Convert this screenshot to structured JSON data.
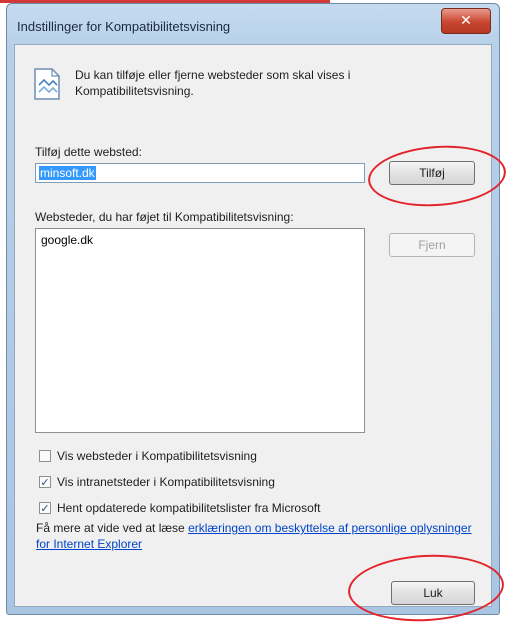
{
  "window": {
    "title": "Indstillinger for Kompatibilitetsvisning",
    "close_label": "✕"
  },
  "info": {
    "icon": "compat-view-icon",
    "text": "Du kan tilføje eller fjerne websteder som skal vises i Kompatibilitetsvisning."
  },
  "add_site": {
    "label": "Tilføj dette websted:",
    "value": "minsoft.dk",
    "button_label": "Tilføj"
  },
  "sites": {
    "label": "Websteder, du har føjet til Kompatibilitetsvisning:",
    "items": [
      "google.dk"
    ],
    "remove_label": "Fjern"
  },
  "options": [
    {
      "label": "Vis websteder i Kompatibilitetsvisning",
      "checked": false
    },
    {
      "label": "Vis intranetsteder i Kompatibilitetsvisning",
      "checked": true
    },
    {
      "label": "Hent opdaterede kompatibilitetslister fra Microsoft",
      "checked": true
    }
  ],
  "privacy_note": {
    "prefix": "Få mere at vide ved at læse ",
    "link_text": "erklæringen om beskyttelse af personlige oplysninger for Internet Explorer"
  },
  "close_button_label": "Luk",
  "colors": {
    "annotation": "#e2242a",
    "link": "#0044cc",
    "selection": "#3399ff"
  }
}
